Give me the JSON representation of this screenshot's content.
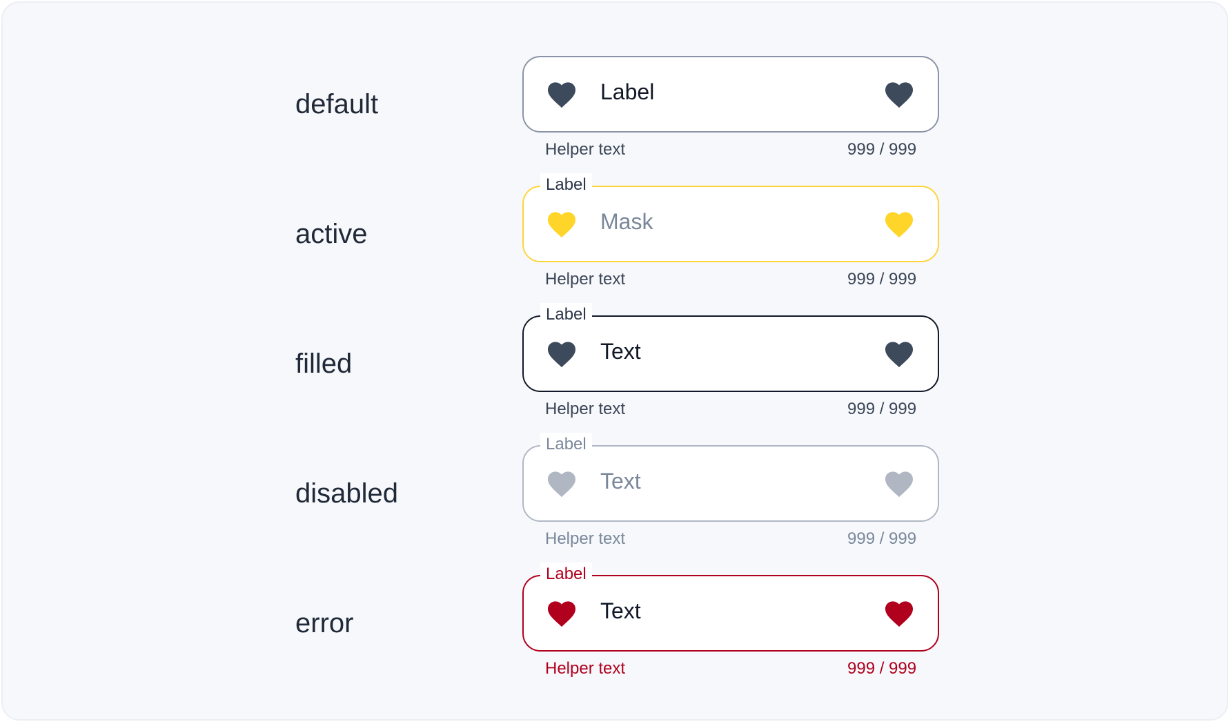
{
  "colors": {
    "background": "#f7f8fb",
    "default_border": "#8a94a6",
    "active_accent": "#ffd529",
    "filled_border": "#111827",
    "disabled": "#b0b7c3",
    "error": "#b0001e",
    "icon_default": "#3d4a5c"
  },
  "states": [
    {
      "name": "default",
      "floating_label": "",
      "value": "Label",
      "helper": "Helper text",
      "counter": "999 / 999",
      "icon_left": "heart-icon",
      "icon_right": "heart-icon"
    },
    {
      "name": "active",
      "floating_label": "Label",
      "value": "Mask",
      "helper": "Helper text",
      "counter": "999 / 999",
      "icon_left": "heart-icon",
      "icon_right": "heart-icon"
    },
    {
      "name": "filled",
      "floating_label": "Label",
      "value": "Text",
      "helper": "Helper text",
      "counter": "999 / 999",
      "icon_left": "heart-icon",
      "icon_right": "heart-icon"
    },
    {
      "name": "disabled",
      "floating_label": "Label",
      "value": "Text",
      "helper": "Helper text",
      "counter": "999 / 999",
      "icon_left": "heart-icon",
      "icon_right": "heart-icon"
    },
    {
      "name": "error",
      "floating_label": "Label",
      "value": "Text",
      "helper": "Helper text",
      "counter": "999 / 999",
      "icon_left": "heart-icon",
      "icon_right": "heart-icon"
    }
  ]
}
